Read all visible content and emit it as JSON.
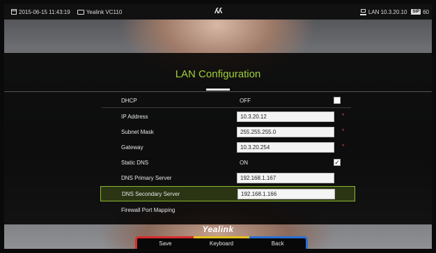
{
  "status_bar": {
    "datetime": "2015-06-15 11:43:19",
    "device": "Yealink VC110",
    "logo": "ʎʎ",
    "lan": "LAN 10.3.20.10",
    "badge": "SIP",
    "badge_tail": "60",
    "icons": [
      "calendar-icon",
      "camera-icon",
      "lan-icon"
    ]
  },
  "page": {
    "title": "LAN Configuration"
  },
  "settings": [
    {
      "label": "DHCP",
      "value": "OFF",
      "kind": "text",
      "checkbox": ""
    },
    {
      "label": "IP Address",
      "value": "10.3.20.12",
      "kind": "input",
      "required": "*"
    },
    {
      "label": "Subnet Mask",
      "value": "255.255.255.0",
      "kind": "input",
      "required": "*"
    },
    {
      "label": "Gateway",
      "value": "10.3.20.254",
      "kind": "input",
      "required": "*"
    },
    {
      "label": "Static DNS",
      "value": "ON",
      "kind": "text",
      "checkbox": "✓"
    },
    {
      "label": "DNS Primary Server",
      "value": "192.168.1.167",
      "kind": "input"
    },
    {
      "label": "DNS Secondary Server",
      "value": "192.168.1.166",
      "kind": "input",
      "selected": true
    },
    {
      "label": "Firewall Port Mapping",
      "value": "",
      "kind": "link"
    }
  ],
  "brand": "Yealink",
  "softkeys": {
    "save": "Save",
    "keyboard": "Keyboard",
    "back": "Back"
  },
  "colors": {
    "title_green": "#9fcf3a",
    "selection_border": "#8dbb2e",
    "required_red": "#e03a3a",
    "softkey_red": "#d92b2b",
    "softkey_yellow": "#e6c21b",
    "softkey_blue": "#2a6fd6"
  }
}
